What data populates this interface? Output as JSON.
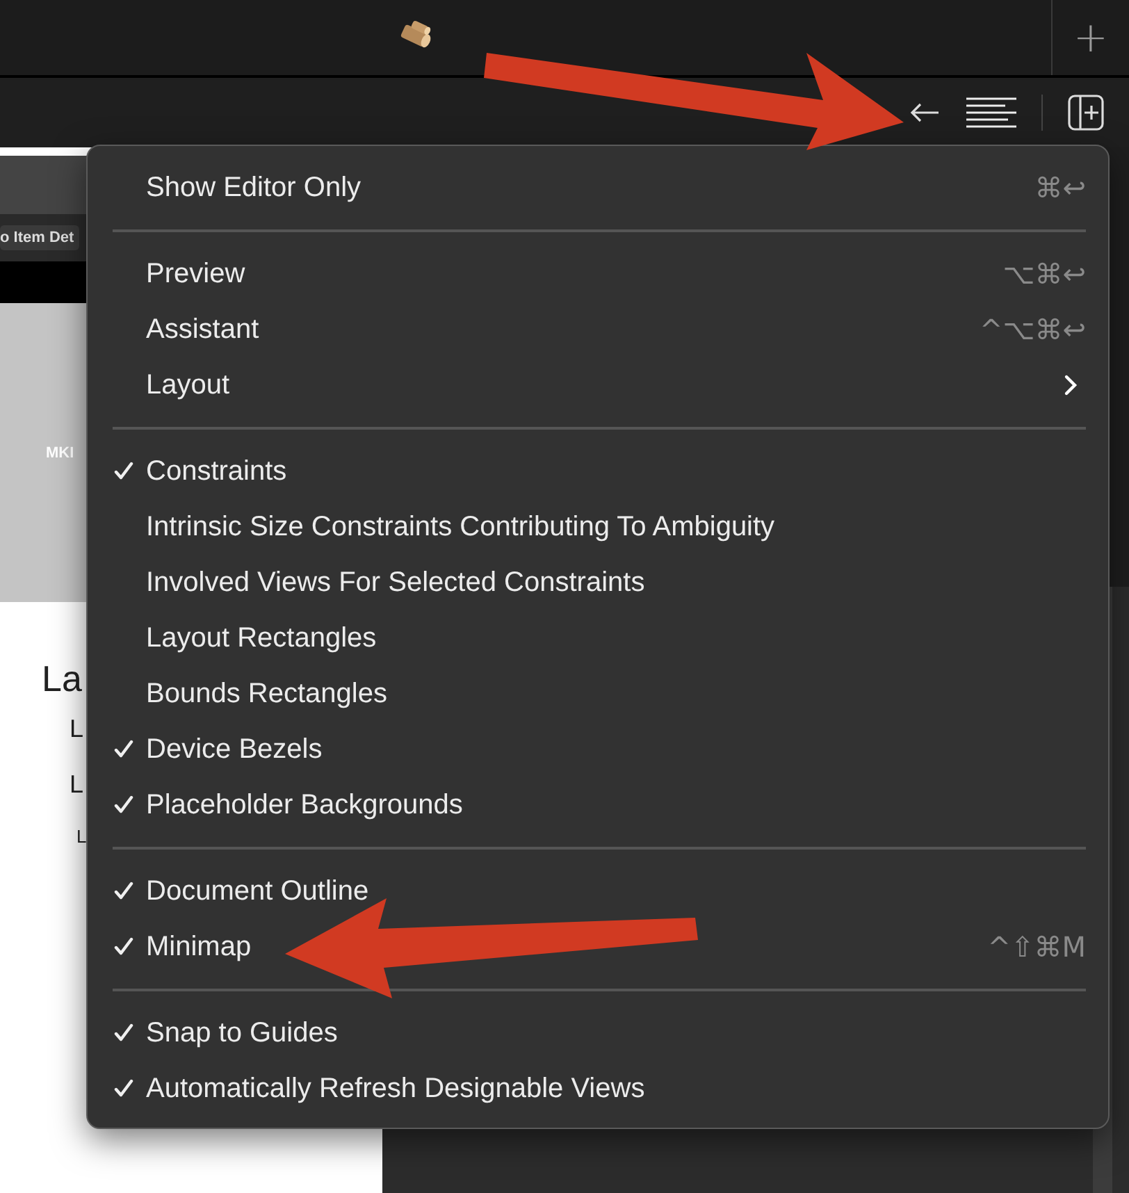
{
  "canvas": {
    "tab_label": "o Item Det",
    "banner_label": "MKI",
    "texts": [
      {
        "text": "La",
        "kind": "title"
      },
      {
        "text": "L",
        "kind": "line"
      },
      {
        "text": "L",
        "kind": "line"
      },
      {
        "text": "L",
        "kind": "small"
      }
    ]
  },
  "menu": {
    "items": [
      {
        "kind": "item",
        "label": "Show Editor Only",
        "checked": false,
        "shortcut": "⌘↩"
      },
      {
        "kind": "separator"
      },
      {
        "kind": "item",
        "label": "Preview",
        "checked": false,
        "shortcut": "⌥⌘↩"
      },
      {
        "kind": "item",
        "label": "Assistant",
        "checked": false,
        "shortcut": "^⌥⌘↩"
      },
      {
        "kind": "submenu",
        "label": "Layout",
        "checked": false
      },
      {
        "kind": "separator"
      },
      {
        "kind": "item",
        "label": "Constraints",
        "checked": true
      },
      {
        "kind": "item",
        "label": "Intrinsic Size Constraints Contributing To Ambiguity",
        "checked": false
      },
      {
        "kind": "item",
        "label": "Involved Views For Selected Constraints",
        "checked": false
      },
      {
        "kind": "item",
        "label": "Layout Rectangles",
        "checked": false
      },
      {
        "kind": "item",
        "label": "Bounds Rectangles",
        "checked": false
      },
      {
        "kind": "item",
        "label": "Device Bezels",
        "checked": true
      },
      {
        "kind": "item",
        "label": "Placeholder Backgrounds",
        "checked": true
      },
      {
        "kind": "separator"
      },
      {
        "kind": "item",
        "label": "Document Outline",
        "checked": true
      },
      {
        "kind": "item",
        "label": "Minimap",
        "checked": true,
        "shortcut": "^⇧⌘M"
      },
      {
        "kind": "separator"
      },
      {
        "kind": "item",
        "label": "Snap to Guides",
        "checked": true
      },
      {
        "kind": "item",
        "label": "Automatically Refresh Designable Views",
        "checked": true
      }
    ]
  },
  "top_bar": {
    "add_button": "+"
  }
}
